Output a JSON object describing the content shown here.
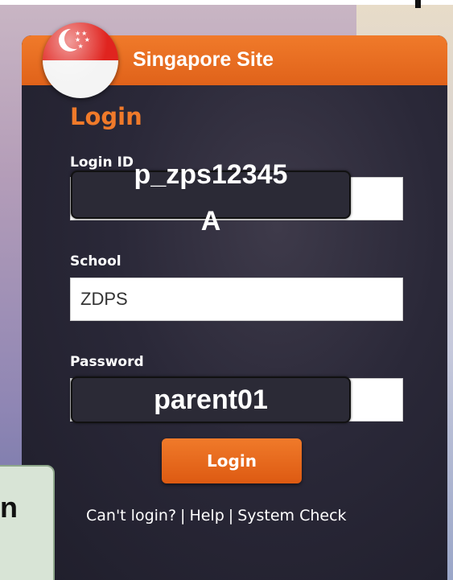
{
  "header": {
    "title": "Singapore Site",
    "flag_icon": "singapore-flag-icon"
  },
  "section_title": "Login",
  "fields": {
    "login_id": {
      "label": "Login ID",
      "value": "",
      "overlay_text_line1": "p_zps12345",
      "overlay_text_line2": "A"
    },
    "school": {
      "label": "School",
      "value": "ZDPS"
    },
    "password": {
      "label": "Password",
      "value": "",
      "overlay_text": "parent01"
    }
  },
  "login_button": {
    "label": "Login"
  },
  "links": {
    "cant_login": "Can't login?",
    "sep1": "|",
    "help": "Help",
    "sep2": "|",
    "system_check": "System Check"
  },
  "side_card": {
    "text": "n"
  },
  "colors": {
    "accent": "#f07a2a",
    "panel_bg": "#2a2838",
    "text_light": "#ffffff"
  }
}
